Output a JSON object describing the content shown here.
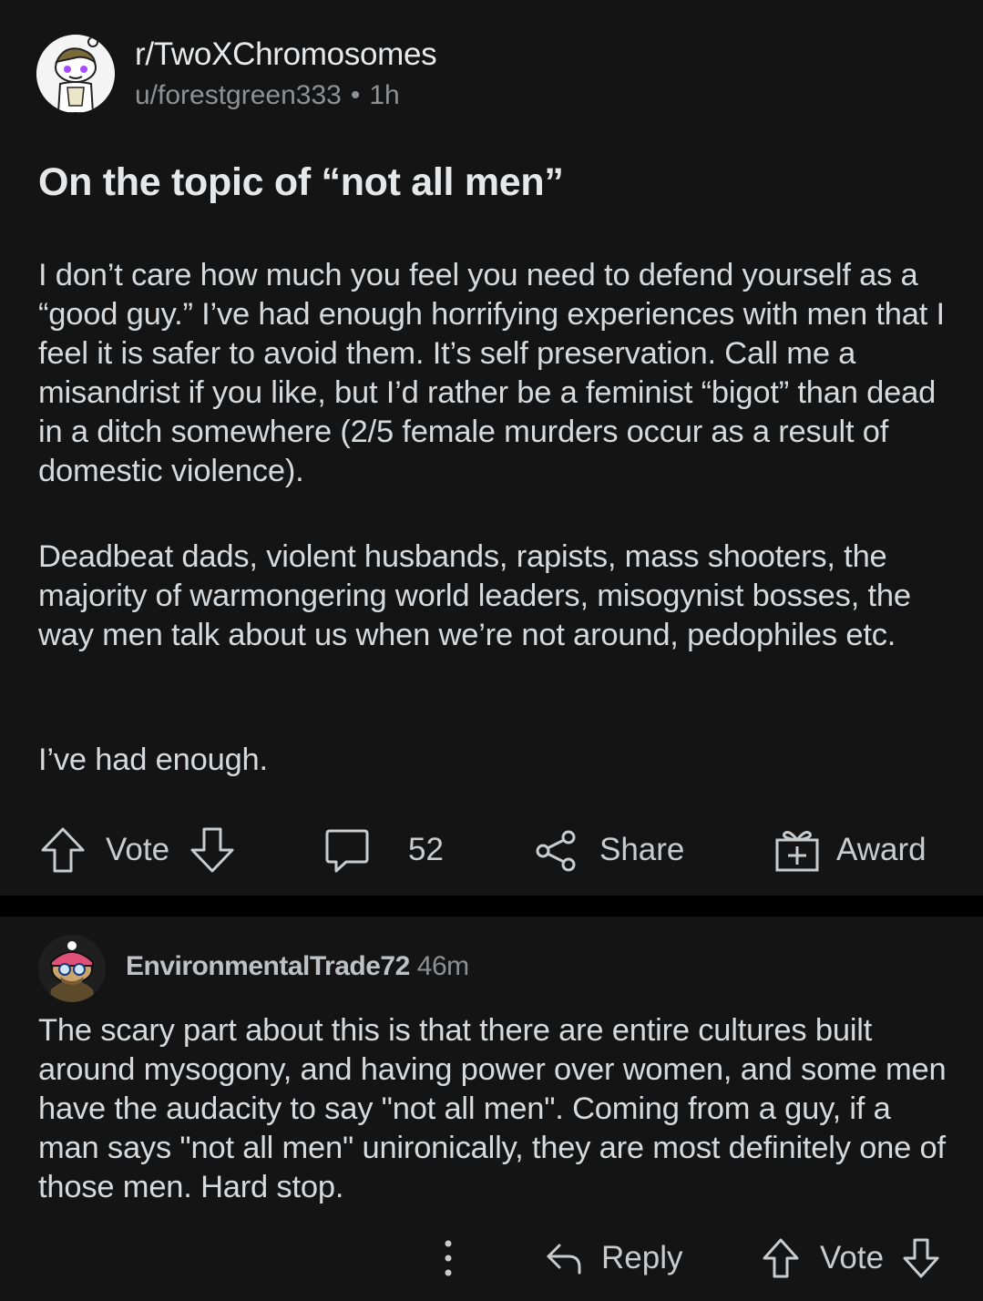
{
  "post": {
    "subreddit": "r/TwoXChromosomes",
    "author": "u/forestgreen333",
    "separator": "•",
    "age": "1h",
    "title": "On the topic of “not all men”",
    "paragraphs": [
      "I don’t care how much you feel you need to defend yourself as a “good guy.” I’ve had enough horrifying experiences with men that I feel it is safer to avoid them. It’s self preservation. Call me a misandrist if you like, but I’d rather be a feminist “bigot” than dead in a ditch somewhere (2/5 female murders occur as a result of domestic violence).",
      "Deadbeat dads, violent husbands, rapists, mass shooters, the majority of warmongering world leaders, misogynist bosses, the way men talk about us when we’re not around, pedophiles etc.",
      "I’ve had enough."
    ],
    "actions": {
      "vote_label": "Vote",
      "comment_count": "52",
      "share_label": "Share",
      "award_label": "Award"
    }
  },
  "comment": {
    "author": "EnvironmentalTrade72",
    "age": "46m",
    "body": "The scary part about this is that there are entire cultures built around mysogony, and having power over women, and some men have the audacity to say \"not all men\". Coming from a guy, if a man says \"not all men\" unironically, they are most definitely one of those men. Hard stop.",
    "actions": {
      "reply_label": "Reply",
      "vote_label": "Vote"
    }
  },
  "icons": {
    "upvote": "arrow-up-outline-icon",
    "downvote": "arrow-down-outline-icon",
    "comment": "speech-bubble-icon",
    "share": "share-nodes-icon",
    "award": "gift-box-icon",
    "more": "vertical-ellipsis-icon",
    "reply": "reply-arrow-icon"
  },
  "colors": {
    "background": "#000000",
    "card": "#141414",
    "text": "#d7dadc",
    "muted": "#8e9194"
  }
}
